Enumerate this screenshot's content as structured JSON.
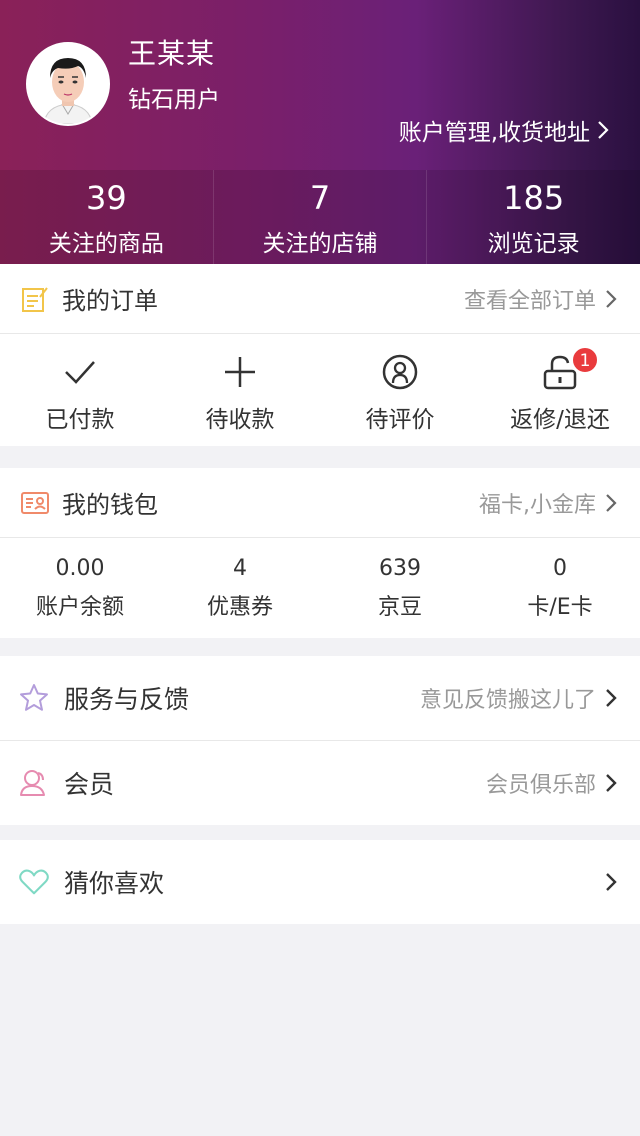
{
  "profile": {
    "name": "王某某",
    "level": "钻石用户",
    "account_link": "账户管理,收货地址"
  },
  "stats": [
    {
      "value": "39",
      "label": "关注的商品"
    },
    {
      "value": "7",
      "label": "关注的店铺"
    },
    {
      "value": "185",
      "label": "浏览记录"
    }
  ],
  "orders": {
    "title": "我的订单",
    "view_all": "查看全部订单",
    "items": [
      {
        "label": "已付款",
        "icon": "check-icon"
      },
      {
        "label": "待收款",
        "icon": "plus-icon"
      },
      {
        "label": "待评价",
        "icon": "review-icon"
      },
      {
        "label": "返修/退还",
        "icon": "unlock-icon",
        "badge": "1"
      }
    ]
  },
  "wallet": {
    "title": "我的钱包",
    "link": "福卡,小金库",
    "items": [
      {
        "value": "0.00",
        "label": "账户余额"
      },
      {
        "value": "4",
        "label": "优惠券"
      },
      {
        "value": "639",
        "label": "京豆"
      },
      {
        "value": "0",
        "label": "卡/E卡"
      }
    ]
  },
  "service": {
    "title": "服务与反馈",
    "link": "意见反馈搬这儿了"
  },
  "member": {
    "title": "会员",
    "link": "会员俱乐部"
  },
  "guess": {
    "title": "猜你喜欢"
  },
  "colors": {
    "order_icon": "#f2c54a",
    "wallet_icon": "#f08a6a",
    "service_icon": "#b39ddb",
    "member_icon": "#e68bb0",
    "guess_icon": "#7fd9c4",
    "badge": "#e93b3d"
  }
}
